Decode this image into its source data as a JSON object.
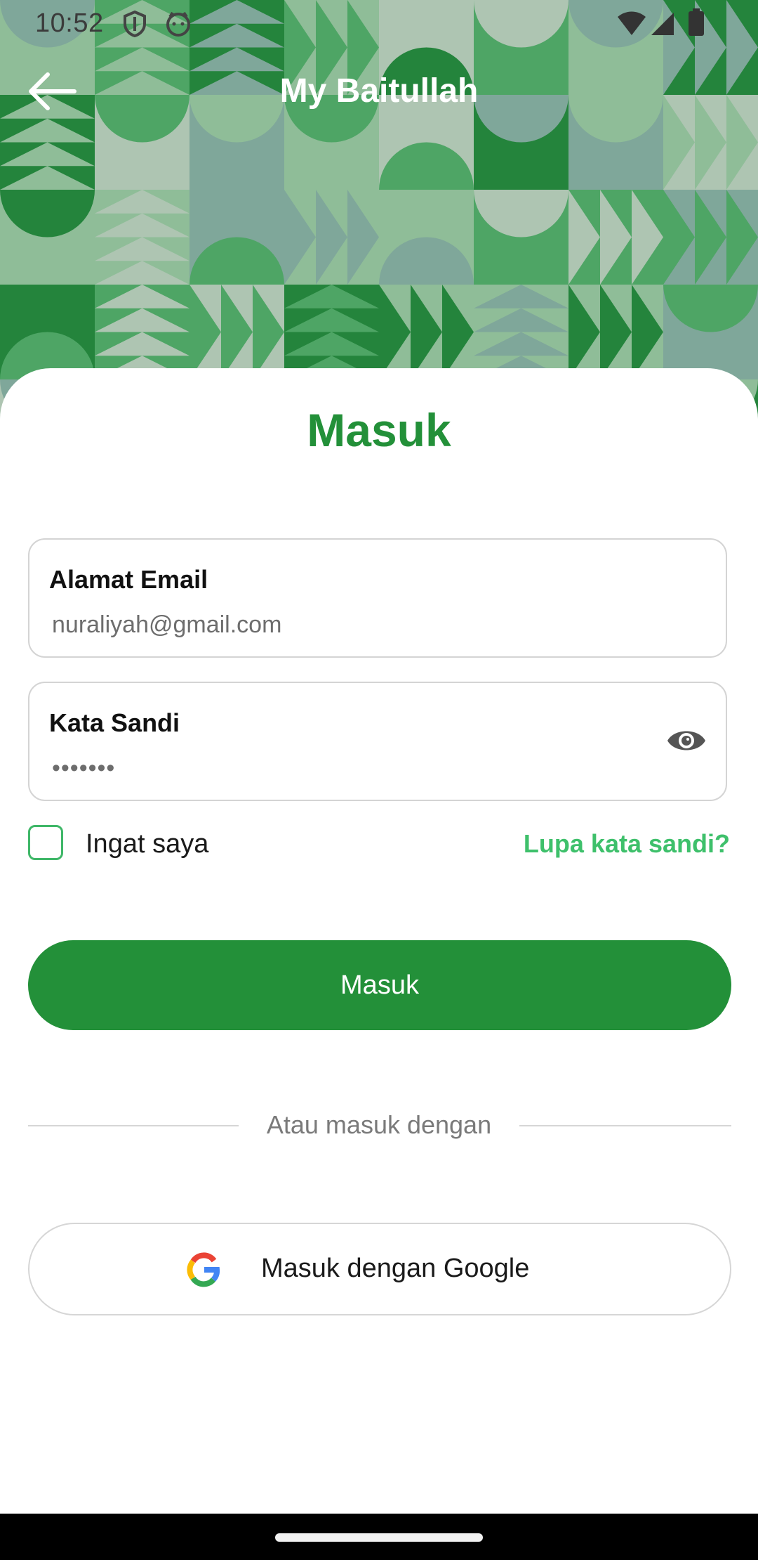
{
  "status_bar": {
    "time": "10:52",
    "icons": [
      "shield-icon",
      "face-icon",
      "wifi-icon",
      "signal-icon",
      "battery-icon"
    ]
  },
  "app_bar": {
    "title": "My Baitullah",
    "back_icon": "arrow-left-icon"
  },
  "login": {
    "heading": "Masuk",
    "email": {
      "label": "Alamat Email",
      "placeholder": "nuraliyah@gmail.com"
    },
    "password": {
      "label": "Kata Sandi",
      "value": "•••••••",
      "toggle_icon": "eye-icon"
    },
    "remember_label": "Ingat saya",
    "forgot_label": "Lupa kata sandi?",
    "submit_label": "Masuk",
    "divider_text": "Atau masuk dengan",
    "google_label": "Masuk dengan Google"
  },
  "colors": {
    "brand_green": "#239039",
    "link_green": "#3ec06b",
    "pattern_dark": "#24843c",
    "pattern_mid": "#4ea565",
    "pattern_light": "#8fbd98",
    "pattern_pale": "#aec5b2",
    "pattern_slate": "#7fa79a"
  }
}
